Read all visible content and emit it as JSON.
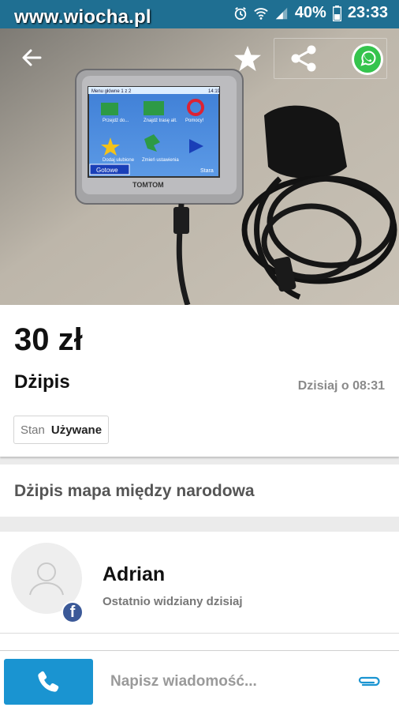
{
  "watermark": "www.wiocha.pl",
  "status": {
    "battery": "40%",
    "time": "23:33"
  },
  "device_screen": {
    "menu": "Menu główne 1 z 2",
    "clock": "14:19",
    "items": [
      "Przejdź do...",
      "Znajdź trasę alt.",
      "Pomocy!",
      "Dodaj ulubione",
      "Zmień ustawienia"
    ],
    "done": "Gotowe",
    "brand": "TOMTOM",
    "start": "Stara"
  },
  "listing": {
    "price": "30 zł",
    "title": "Dżipis",
    "date": "Dzisiaj o 08:31",
    "condition_label": "Stan",
    "condition_value": "Używane",
    "description": "Dżipis mapa między narodowa"
  },
  "seller": {
    "name": "Adrian",
    "last_seen": "Ostatnio widziany dzisiaj",
    "badge": "f"
  },
  "bottom": {
    "message_placeholder": "Napisz wiadomość..."
  },
  "colors": {
    "status_bar": "#1f6f92",
    "call_button": "#1a94d1",
    "attach_icon": "#1a94d1",
    "facebook": "#3b5998",
    "whatsapp": "#35c44d"
  },
  "icons": {
    "back": "arrow-left-icon",
    "favorite": "star-icon",
    "share": "share-icon",
    "whatsapp": "whatsapp-icon",
    "call": "phone-icon",
    "attach": "paperclip-icon",
    "avatar": "user-icon"
  }
}
